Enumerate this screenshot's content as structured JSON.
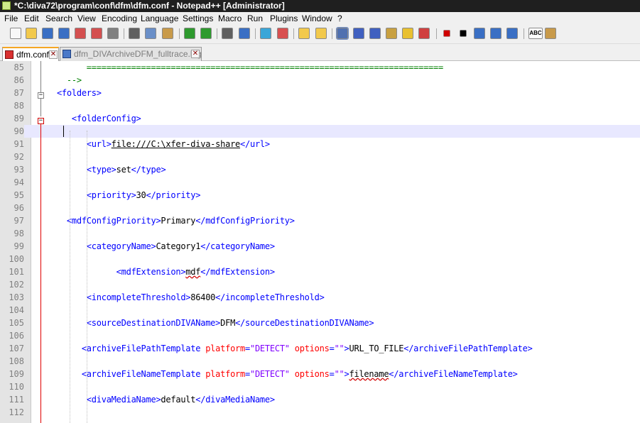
{
  "window": {
    "title": "*C:\\diva72\\program\\conf\\dfm\\dfm.conf - Notepad++ [Administrator]"
  },
  "menu": [
    "File",
    "Edit",
    "Search",
    "View",
    "Encoding",
    "Language",
    "Settings",
    "Macro",
    "Run",
    "Plugins",
    "Window",
    "?"
  ],
  "toolbar": {
    "icons": [
      "new-file-icon",
      "open-file-icon",
      "save-icon",
      "save-all-icon",
      "close-icon",
      "close-all-icon",
      "print-icon",
      "cut-icon",
      "copy-icon",
      "paste-icon",
      "undo-icon",
      "redo-icon",
      "find-icon",
      "replace-icon",
      "zoom-in-icon",
      "zoom-out-icon",
      "sync-vertical-icon",
      "sync-horizontal-icon",
      "word-wrap-icon",
      "show-all-chars-icon",
      "indent-guide-icon",
      "udl-icon",
      "doc-map-icon",
      "function-list-icon",
      "record-macro-icon",
      "stop-record-icon",
      "play-macro-icon",
      "run-macro-multiple-icon",
      "save-macro-icon",
      "spell-check-icon",
      "doc-switcher-icon"
    ],
    "spellcheck_label": "ABC"
  },
  "tabs": [
    {
      "label": "dfm.conf",
      "active": true
    },
    {
      "label": "dfm_DIVArchiveDFM_fulltrace.log",
      "active": false
    }
  ],
  "colors": {
    "tag": "#0000ff",
    "attribute": "#ff0000",
    "value": "#8000ff",
    "comment": "#008000",
    "current_line": "#e8e8ff",
    "modified_marker": "#e00000",
    "active_tab_accent": "#f5a623"
  },
  "editor": {
    "current_line": 90,
    "lines": [
      {
        "n": "85",
        "parts": [
          {
            "t": "        ========================================================================",
            "c": "comment"
          }
        ]
      },
      {
        "n": "86",
        "parts": [
          {
            "t": "    -->",
            "c": "comment"
          }
        ]
      },
      {
        "n": "87",
        "parts": [
          {
            "t": "  <folders>",
            "c": "tag"
          }
        ]
      },
      {
        "n": "88",
        "parts": []
      },
      {
        "n": "89",
        "parts": [
          {
            "t": "     <folderConfig>",
            "c": "tag"
          }
        ]
      },
      {
        "n": "90",
        "parts": []
      },
      {
        "n": "91",
        "parts": [
          {
            "t": "        <url>",
            "c": "tag"
          },
          {
            "t": "file:///C:\\xfer-diva-share",
            "c": "text ul"
          },
          {
            "t": "</url>",
            "c": "tag"
          }
        ]
      },
      {
        "n": "92",
        "parts": []
      },
      {
        "n": "93",
        "parts": [
          {
            "t": "        <type>",
            "c": "tag"
          },
          {
            "t": "set",
            "c": "text"
          },
          {
            "t": "</type>",
            "c": "tag"
          }
        ]
      },
      {
        "n": "94",
        "parts": []
      },
      {
        "n": "95",
        "parts": [
          {
            "t": "        <priority>",
            "c": "tag"
          },
          {
            "t": "30",
            "c": "text"
          },
          {
            "t": "</priority>",
            "c": "tag"
          }
        ]
      },
      {
        "n": "96",
        "parts": []
      },
      {
        "n": "97",
        "parts": [
          {
            "t": "    <mdfConfigPriority>",
            "c": "tag"
          },
          {
            "t": "Primary",
            "c": "text"
          },
          {
            "t": "</mdfConfigPriority>",
            "c": "tag"
          }
        ]
      },
      {
        "n": "98",
        "parts": []
      },
      {
        "n": "99",
        "parts": [
          {
            "t": "        <categoryName>",
            "c": "tag"
          },
          {
            "t": "Category1",
            "c": "text"
          },
          {
            "t": "</categoryName>",
            "c": "tag"
          }
        ]
      },
      {
        "n": "100",
        "parts": []
      },
      {
        "n": "101",
        "parts": [
          {
            "t": "              <mdfExtension>",
            "c": "tag"
          },
          {
            "t": "mdf",
            "c": "text squig"
          },
          {
            "t": "</mdfExtension>",
            "c": "tag"
          }
        ]
      },
      {
        "n": "102",
        "parts": []
      },
      {
        "n": "103",
        "parts": [
          {
            "t": "        <incompleteThreshold>",
            "c": "tag"
          },
          {
            "t": "86400",
            "c": "text"
          },
          {
            "t": "</incompleteThreshold>",
            "c": "tag"
          }
        ]
      },
      {
        "n": "104",
        "parts": []
      },
      {
        "n": "105",
        "parts": [
          {
            "t": "        <sourceDestinationDIVAName>",
            "c": "tag"
          },
          {
            "t": "DFM",
            "c": "text"
          },
          {
            "t": "</sourceDestinationDIVAName>",
            "c": "tag"
          }
        ]
      },
      {
        "n": "106",
        "parts": []
      },
      {
        "n": "107",
        "parts": [
          {
            "t": "       <archiveFilePathTemplate",
            "c": "tag"
          },
          {
            "t": " platform",
            "c": "attr"
          },
          {
            "t": "=",
            "c": "tag"
          },
          {
            "t": "\"DETECT\"",
            "c": "val"
          },
          {
            "t": " options",
            "c": "attr"
          },
          {
            "t": "=",
            "c": "tag"
          },
          {
            "t": "\"\"",
            "c": "val"
          },
          {
            "t": ">",
            "c": "tag"
          },
          {
            "t": "URL_TO_FILE",
            "c": "text"
          },
          {
            "t": "</archiveFilePathTemplate>",
            "c": "tag"
          }
        ]
      },
      {
        "n": "108",
        "parts": []
      },
      {
        "n": "109",
        "parts": [
          {
            "t": "       <archiveFileNameTemplate",
            "c": "tag"
          },
          {
            "t": " platform",
            "c": "attr"
          },
          {
            "t": "=",
            "c": "tag"
          },
          {
            "t": "\"DETECT\"",
            "c": "val"
          },
          {
            "t": " options",
            "c": "attr"
          },
          {
            "t": "=",
            "c": "tag"
          },
          {
            "t": "\"\"",
            "c": "val"
          },
          {
            "t": ">",
            "c": "tag"
          },
          {
            "t": "filename",
            "c": "text squig"
          },
          {
            "t": "</archiveFileNameTemplate>",
            "c": "tag"
          }
        ]
      },
      {
        "n": "110",
        "parts": []
      },
      {
        "n": "111",
        "parts": [
          {
            "t": "        <divaMediaName>",
            "c": "tag"
          },
          {
            "t": "default",
            "c": "text"
          },
          {
            "t": "</divaMediaName>",
            "c": "tag"
          }
        ]
      },
      {
        "n": "112",
        "parts": []
      }
    ]
  }
}
